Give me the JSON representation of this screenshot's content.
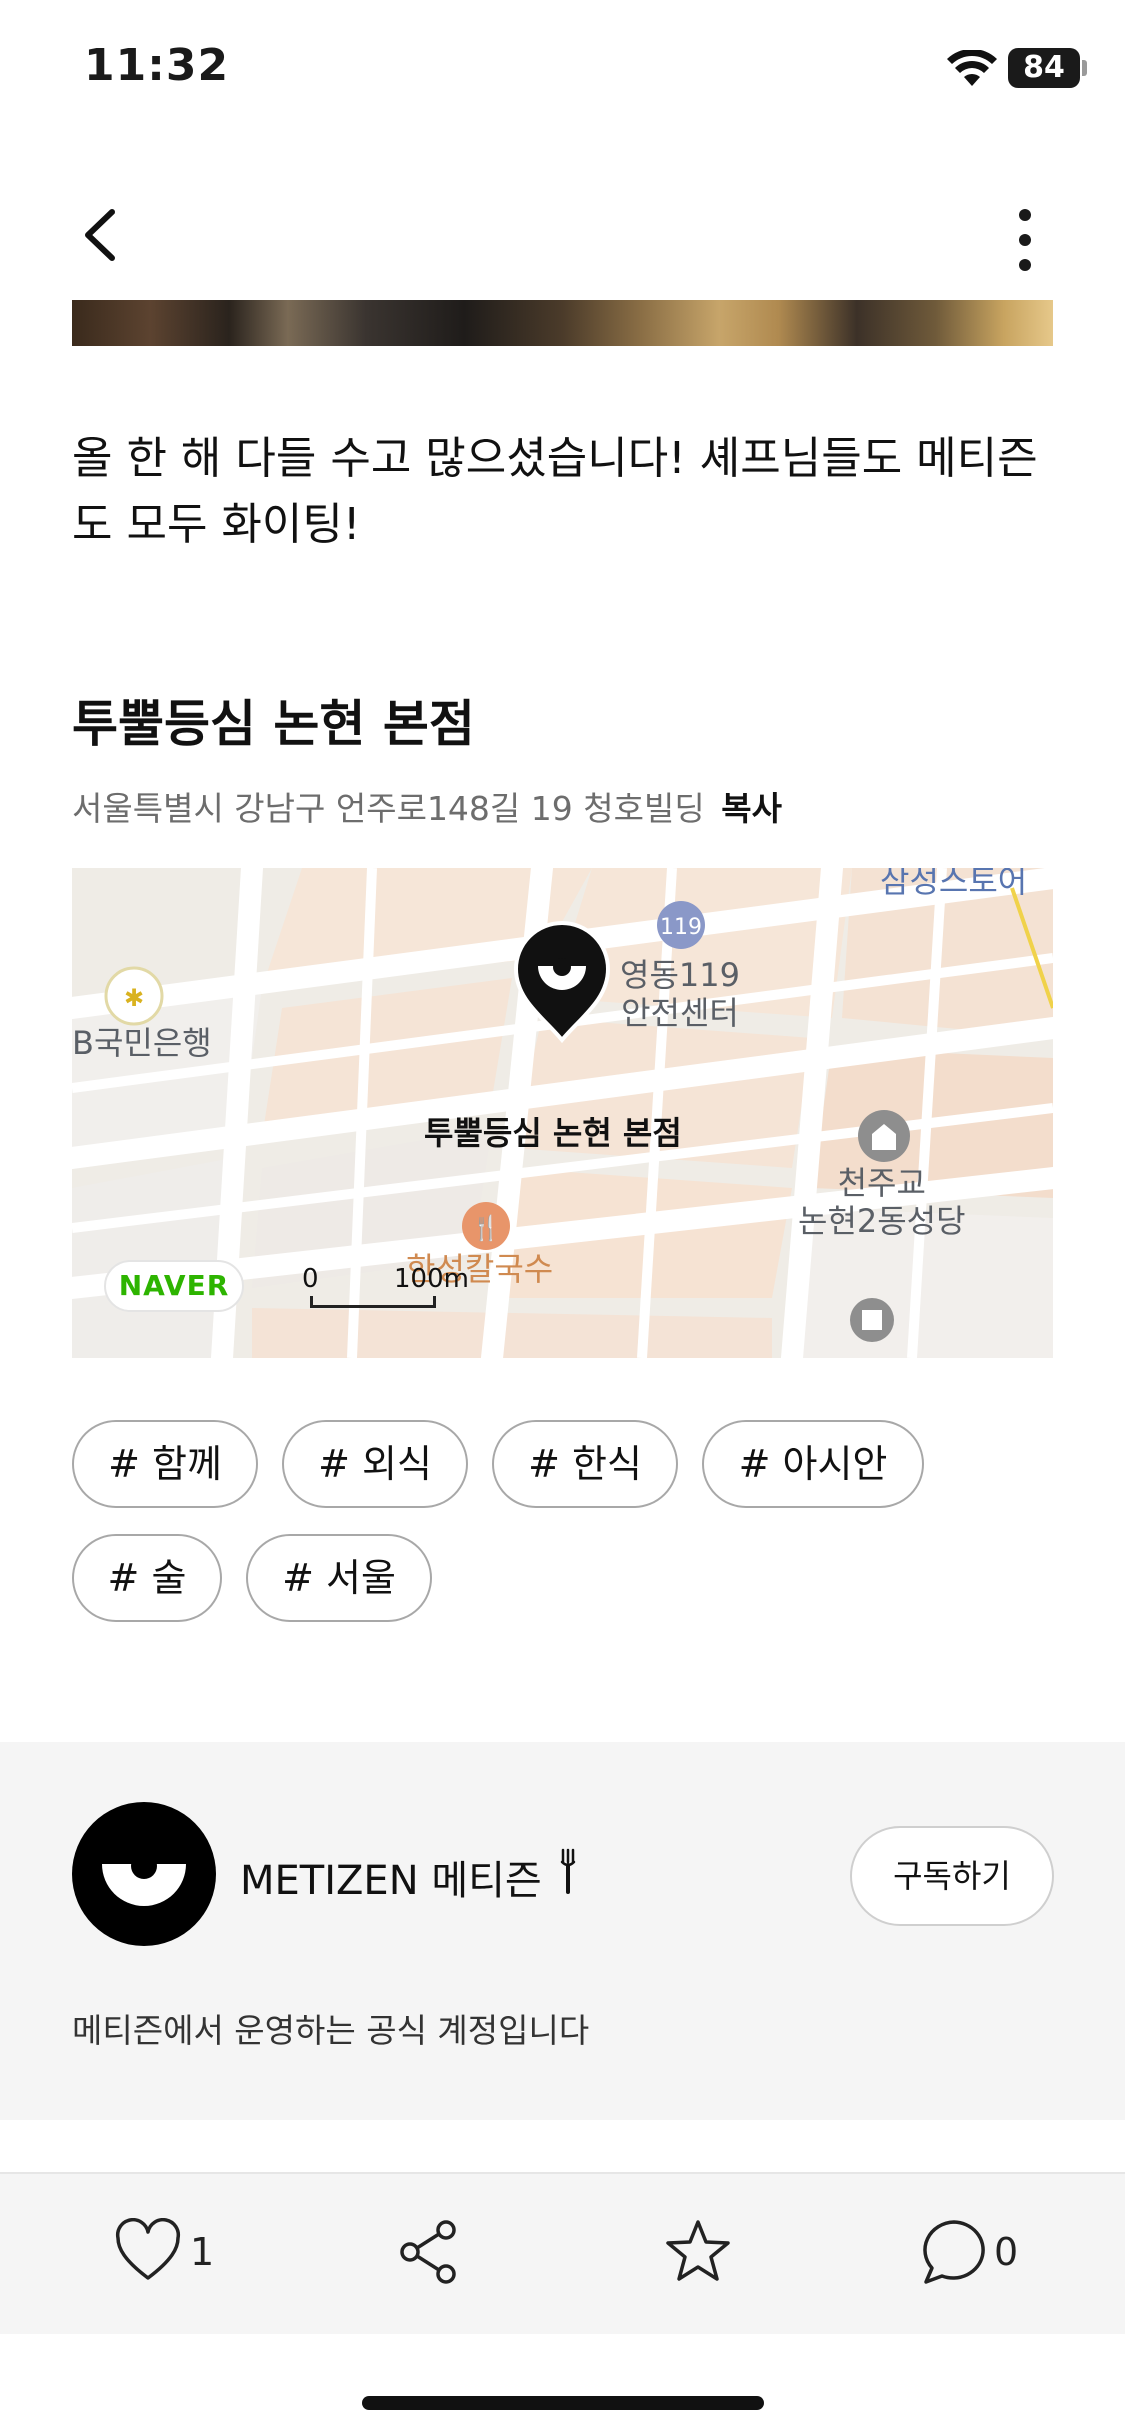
{
  "status_bar": {
    "time": "11:32",
    "battery": "84"
  },
  "post": {
    "text": "올 한 해 다들 수고 많으셨습니다! 셰프님들도 메티즌도 모두 화이팅!"
  },
  "place": {
    "name": "투뿔등심 논현 본점",
    "address": "서울특별시 강남구 언주로148길 19 청호빌딩",
    "copy_label": "복사"
  },
  "map": {
    "labels": {
      "samsung": "삼성스토어",
      "fire_station_line1": "영동119",
      "fire_station_line2": "안전센터",
      "kb_bank": "B국민은행",
      "restaurant": "투뿔등심 논현 본점",
      "church_line1": "천주교",
      "church_line2": "논현2동성당",
      "kalguksu": "한성칼국수"
    },
    "naver": "NAVER",
    "scale_zero": "0",
    "scale_unit": "100m"
  },
  "tags": [
    "# 함께",
    "# 외식",
    "# 한식",
    "# 아시안",
    "# 술",
    "# 서울"
  ],
  "author": {
    "name": "METIZEN 메티즌",
    "subscribe_label": "구독하기",
    "description": "메티즌에서 운영하는 공식 계정입니다"
  },
  "actions": {
    "likes": "1",
    "comments": "0"
  }
}
